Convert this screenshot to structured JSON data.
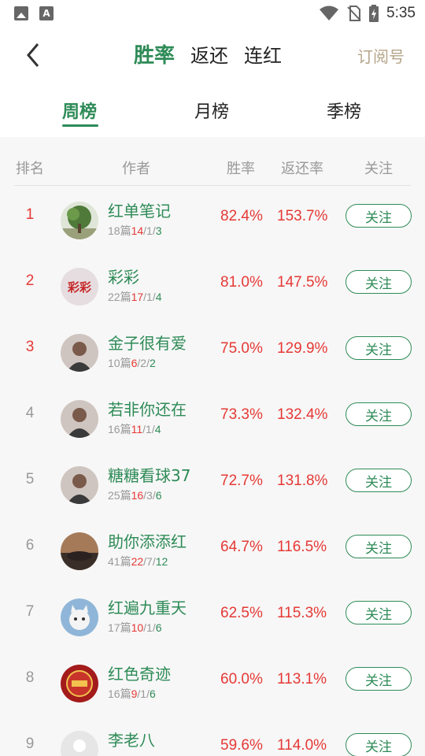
{
  "status_bar": {
    "time": "5:35",
    "a_icon_letter": "A"
  },
  "header": {
    "tabs": [
      "胜率",
      "返还",
      "连红"
    ],
    "subscribe": "订阅号",
    "period_tabs": [
      "周榜",
      "月榜",
      "季榜"
    ]
  },
  "columns": {
    "rank": "排名",
    "author": "作者",
    "winrate": "胜率",
    "return": "返还率",
    "follow": "关注"
  },
  "colors": {
    "accent": "#2e8b57",
    "red": "#e53935",
    "gold": "#b5a58a"
  },
  "rows": [
    {
      "rank": "1",
      "name": "红单笔记",
      "posts": "18篇",
      "w": "14",
      "d": "1",
      "l": "3",
      "winrate": "82.4%",
      "return": "153.7%",
      "follow": "关注",
      "avatar": "tree-avatar"
    },
    {
      "rank": "2",
      "name": "彩彩",
      "posts": "22篇",
      "w": "17",
      "d": "1",
      "l": "4",
      "winrate": "81.0%",
      "return": "147.5%",
      "follow": "关注",
      "avatar": "text-logo-avatar",
      "avatar_text": "彩彩"
    },
    {
      "rank": "3",
      "name": "金子很有爱",
      "posts": "10篇",
      "w": "6",
      "d": "2",
      "l": "2",
      "winrate": "75.0%",
      "return": "129.9%",
      "follow": "关注",
      "avatar": "person-avatar"
    },
    {
      "rank": "4",
      "name": "若非你还在",
      "posts": "16篇",
      "w": "11",
      "d": "1",
      "l": "4",
      "winrate": "73.3%",
      "return": "132.4%",
      "follow": "关注",
      "avatar": "person-avatar"
    },
    {
      "rank": "5",
      "name": "糖糖看球37",
      "posts": "25篇",
      "w": "16",
      "d": "3",
      "l": "6",
      "winrate": "72.7%",
      "return": "131.8%",
      "follow": "关注",
      "avatar": "person-avatar"
    },
    {
      "rank": "6",
      "name": "助你添添红",
      "posts": "41篇",
      "w": "22",
      "d": "7",
      "l": "12",
      "winrate": "64.7%",
      "return": "116.5%",
      "follow": "关注",
      "avatar": "car-avatar"
    },
    {
      "rank": "7",
      "name": "红遍九重天",
      "posts": "17篇",
      "w": "10",
      "d": "1",
      "l": "6",
      "winrate": "62.5%",
      "return": "115.3%",
      "follow": "关注",
      "avatar": "cat-avatar"
    },
    {
      "rank": "8",
      "name": "红色奇迹",
      "posts": "16篇",
      "w": "9",
      "d": "1",
      "l": "6",
      "winrate": "60.0%",
      "return": "113.1%",
      "follow": "关注",
      "avatar": "badge-avatar"
    },
    {
      "rank": "9",
      "name": "李老八",
      "posts": "",
      "w": "",
      "d": "",
      "l": "",
      "winrate": "59.6%",
      "return": "114.0%",
      "follow": "关注",
      "avatar": "default-avatar"
    }
  ]
}
